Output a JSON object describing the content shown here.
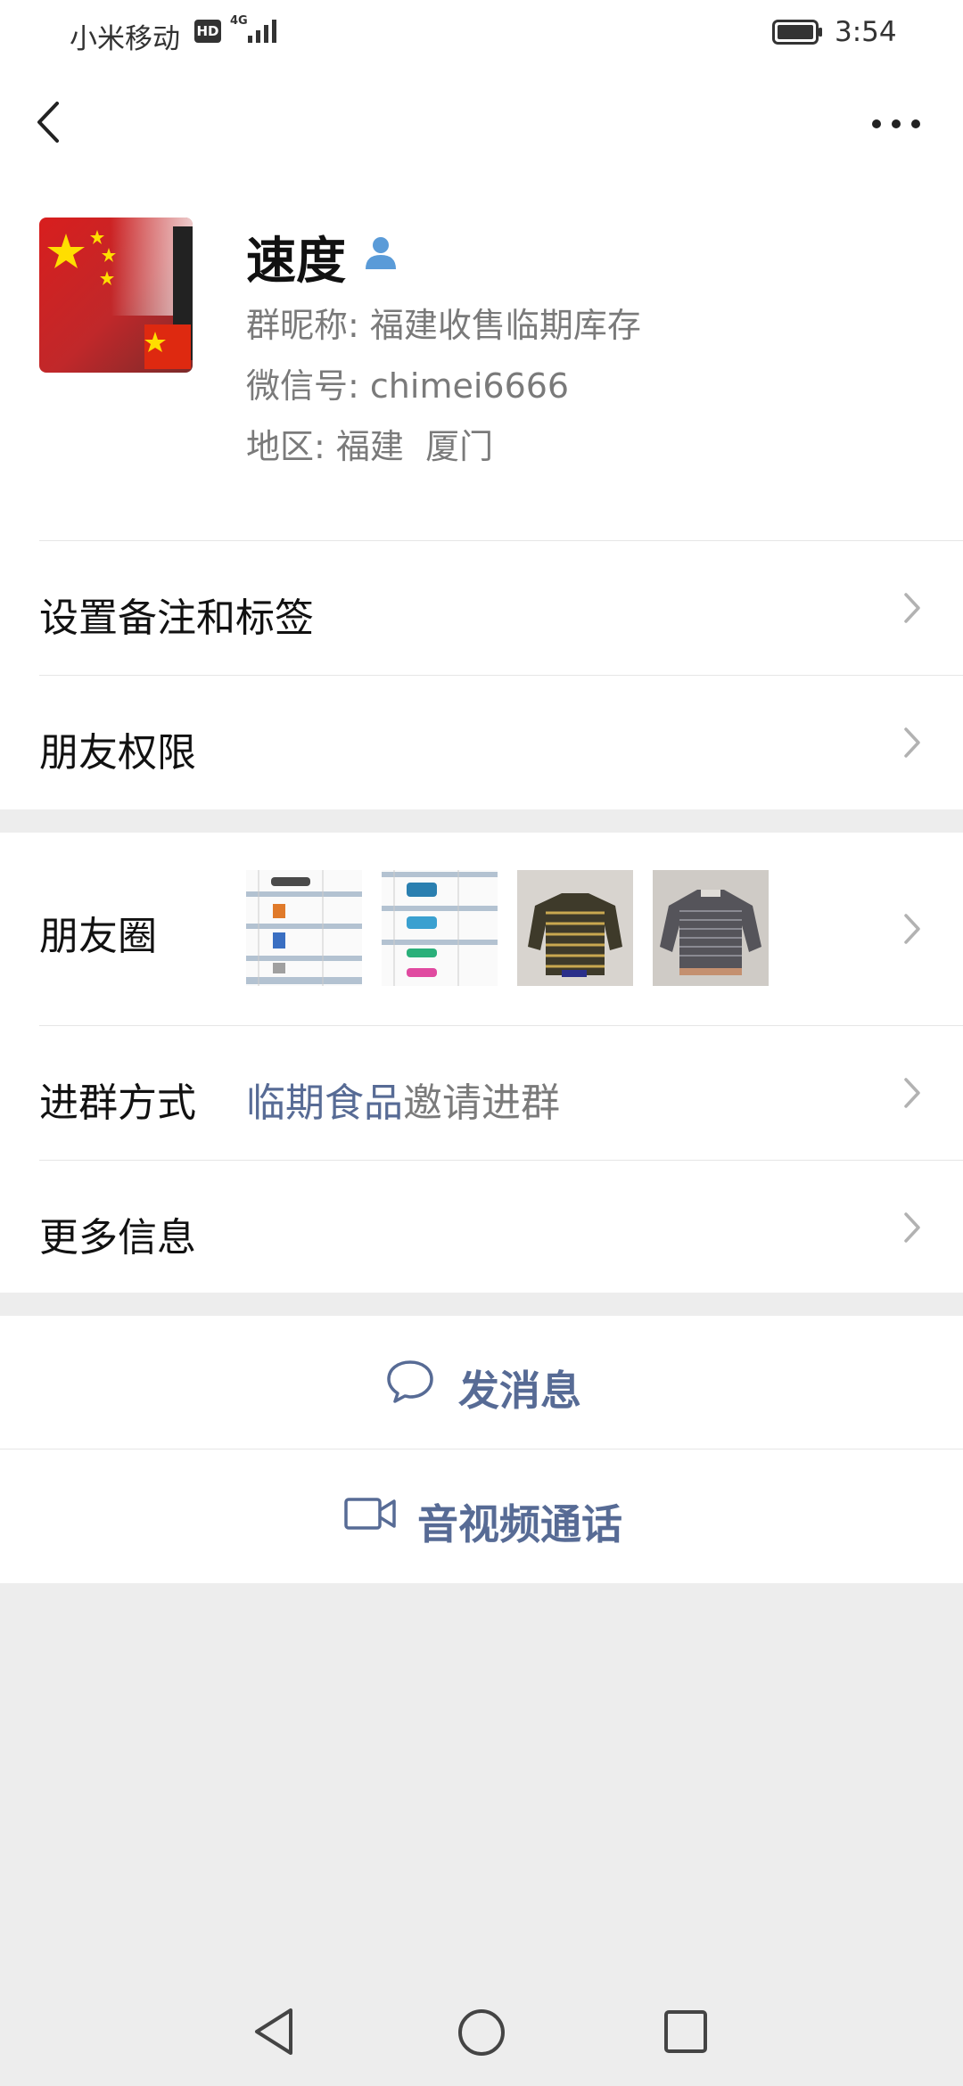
{
  "status_bar": {
    "carrier": "小米移动",
    "hd": "HD",
    "network": "4G",
    "time": "3:54"
  },
  "profile": {
    "name": "速度",
    "nickname_label": "群昵称:",
    "nickname_value": "福建收售临期库存",
    "wechat_id_label": "微信号:",
    "wechat_id_value": "chimei6666",
    "region_label": "地区:",
    "region_value": "福建  厦门"
  },
  "menu": {
    "remark": "设置备注和标签",
    "permissions": "朋友权限",
    "moments": "朋友圈",
    "join_method_label": "进群方式",
    "join_method_link": "临期食品",
    "join_method_suffix": "邀请进群",
    "more_info": "更多信息"
  },
  "actions": {
    "send_message": "发消息",
    "video_call": "音视频通话"
  },
  "colors": {
    "link": "#576b95",
    "background": "#ededed"
  }
}
